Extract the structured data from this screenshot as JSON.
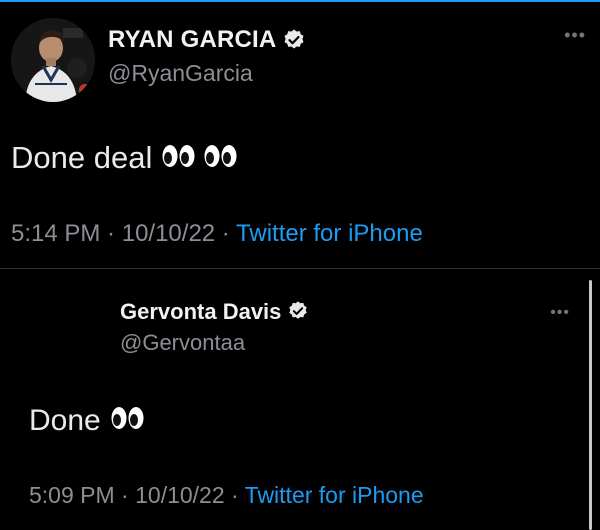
{
  "colors": {
    "background": "#000000",
    "accent": "#1d9bf0",
    "muted": "#8b8f94",
    "text": "#e7e9ea"
  },
  "tweet": {
    "display_name": "RYAN GARCIA",
    "handle": "@RyanGarcia",
    "verified": true,
    "text": "Done deal",
    "emoji": [
      "eyes",
      "eyes"
    ],
    "time": "5:14 PM",
    "date": "10/10/22",
    "source": "Twitter for iPhone",
    "separator": " · ",
    "more_icon": "ellipsis-icon"
  },
  "quoted_tweet": {
    "display_name": "Gervonta Davis",
    "handle": "@Gervontaa",
    "verified": true,
    "text": "Done",
    "emoji": [
      "eyes"
    ],
    "time": "5:09 PM",
    "date": "10/10/22",
    "source": "Twitter for iPhone",
    "separator": " · ",
    "more_icon": "ellipsis-icon"
  }
}
